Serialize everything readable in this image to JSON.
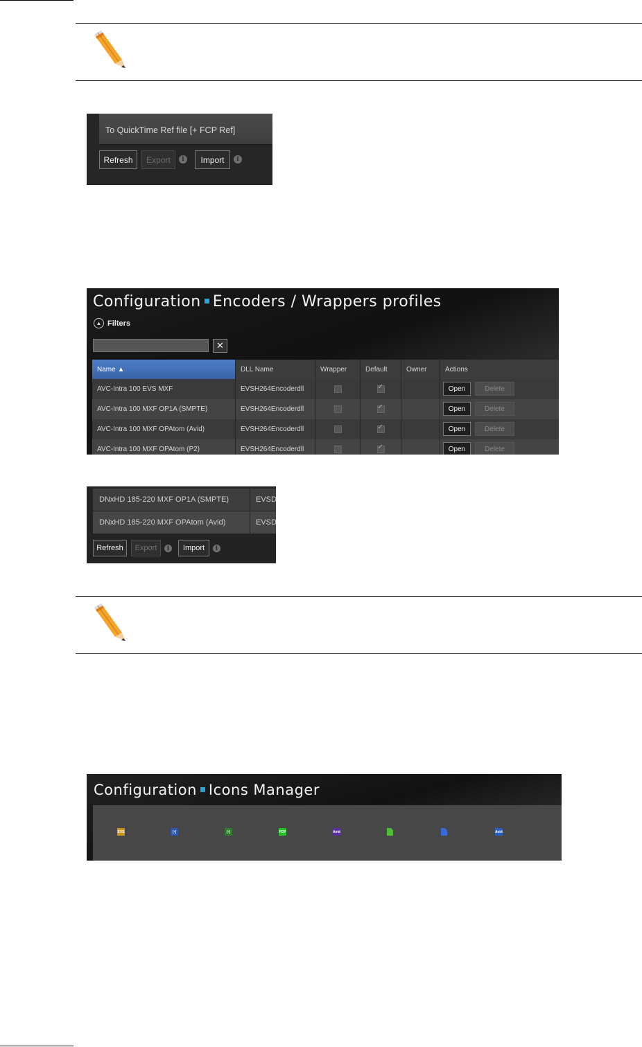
{
  "shot1": {
    "row_label": "To QuickTime Ref file [+ FCP Ref]",
    "refresh_label": "Refresh",
    "export_label": "Export",
    "import_label": "Import",
    "info_glyph": "i"
  },
  "shot2": {
    "title_part1": "Configuration",
    "title_part2": "Encoders / Wrappers profiles",
    "filters_label": "Filters",
    "clear_glyph": "✕",
    "columns": {
      "name": "Name ▲",
      "dll": "DLL Name",
      "wrapper": "Wrapper",
      "default": "Default",
      "owner": "Owner",
      "actions": "Actions"
    },
    "rows": [
      {
        "name": "AVC-Intra 100 EVS MXF",
        "dll": "EVSH264Encoderdll",
        "wrapper": false,
        "default": true
      },
      {
        "name": "AVC-Intra 100 MXF OP1A (SMPTE)",
        "dll": "EVSH264Encoderdll",
        "wrapper": false,
        "default": true
      },
      {
        "name": "AVC-Intra 100 MXF OPAtom (Avid)",
        "dll": "EVSH264Encoderdll",
        "wrapper": false,
        "default": true
      },
      {
        "name": "AVC-Intra 100 MXF OPAtom (P2)",
        "dll": "EVSH264Encoderdll",
        "wrapper": false,
        "default": true
      }
    ],
    "open_label": "Open",
    "delete_label": "Delete"
  },
  "shot3": {
    "rows": [
      {
        "name": "DNxHD 185-220 MXF OP1A (SMPTE)",
        "dll": "EVSD"
      },
      {
        "name": "DNxHD 185-220 MXF OPAtom (Avid)",
        "dll": "EVSD"
      }
    ],
    "refresh_label": "Refresh",
    "export_label": "Export",
    "import_label": "Import",
    "info_glyph": "i"
  },
  "shot4": {
    "title_part1": "Configuration",
    "title_part2": "Icons Manager",
    "icons": [
      {
        "name": "evs-clip-icon",
        "color": "#c8951c",
        "glyph": "EVS"
      },
      {
        "name": "blue-clip-icon",
        "color": "#2d57a8",
        "glyph": "[▪]"
      },
      {
        "name": "green-bracket-icon",
        "color": "#2f7a2f",
        "glyph": "[▪]"
      },
      {
        "name": "fcp-icon",
        "color": "#26c12a",
        "glyph": "FCP"
      },
      {
        "name": "avid-purple-icon",
        "color": "#5a2fa0",
        "glyph": "Avid"
      },
      {
        "name": "green-document-icon",
        "color": "#4fbf3a",
        "glyph": ""
      },
      {
        "name": "blue-document-icon",
        "color": "#3a6ad6",
        "glyph": ""
      },
      {
        "name": "avid-blue-icon",
        "color": "#2b5fbe",
        "glyph": "Avid"
      }
    ]
  }
}
